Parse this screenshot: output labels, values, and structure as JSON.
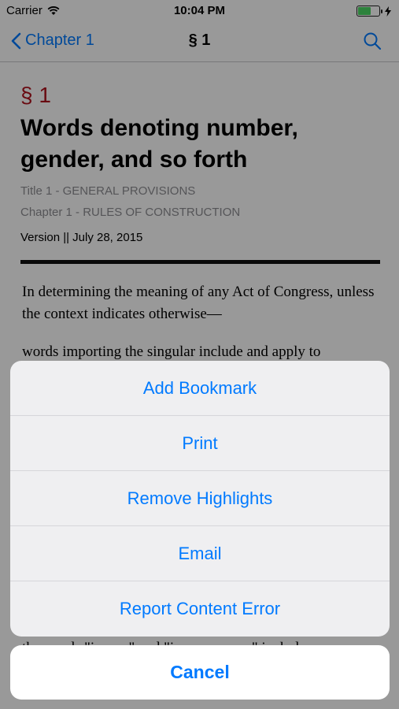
{
  "status_bar": {
    "carrier": "Carrier",
    "time": "10:04 PM",
    "battery_level_percent": 65
  },
  "nav": {
    "back_label": "Chapter 1",
    "title": "§ 1"
  },
  "document": {
    "section_symbol": "§ 1",
    "title": "Words denoting number, gender, and so forth",
    "title_line": "Title 1 - GENERAL PROVISIONS",
    "chapter_line": "Chapter 1 - RULES OF CONSTRUCTION",
    "version": "Version || July 28, 2015",
    "paragraph_1": "In determining the meaning of any Act of Congress, unless the context indicates otherwise—",
    "paragraph_2": "words importing the singular include and apply to",
    "paragraph_3_partial": "the words \"insane\" and \"insane person\" include"
  },
  "action_sheet": {
    "items": [
      {
        "label": "Add Bookmark"
      },
      {
        "label": "Print"
      },
      {
        "label": "Remove Highlights"
      },
      {
        "label": "Email"
      },
      {
        "label": "Report Content Error"
      }
    ],
    "cancel_label": "Cancel"
  },
  "colors": {
    "accent": "#007aff",
    "section_red": "#b0121d",
    "overlay": "rgba(0,0,0,0.4)"
  }
}
